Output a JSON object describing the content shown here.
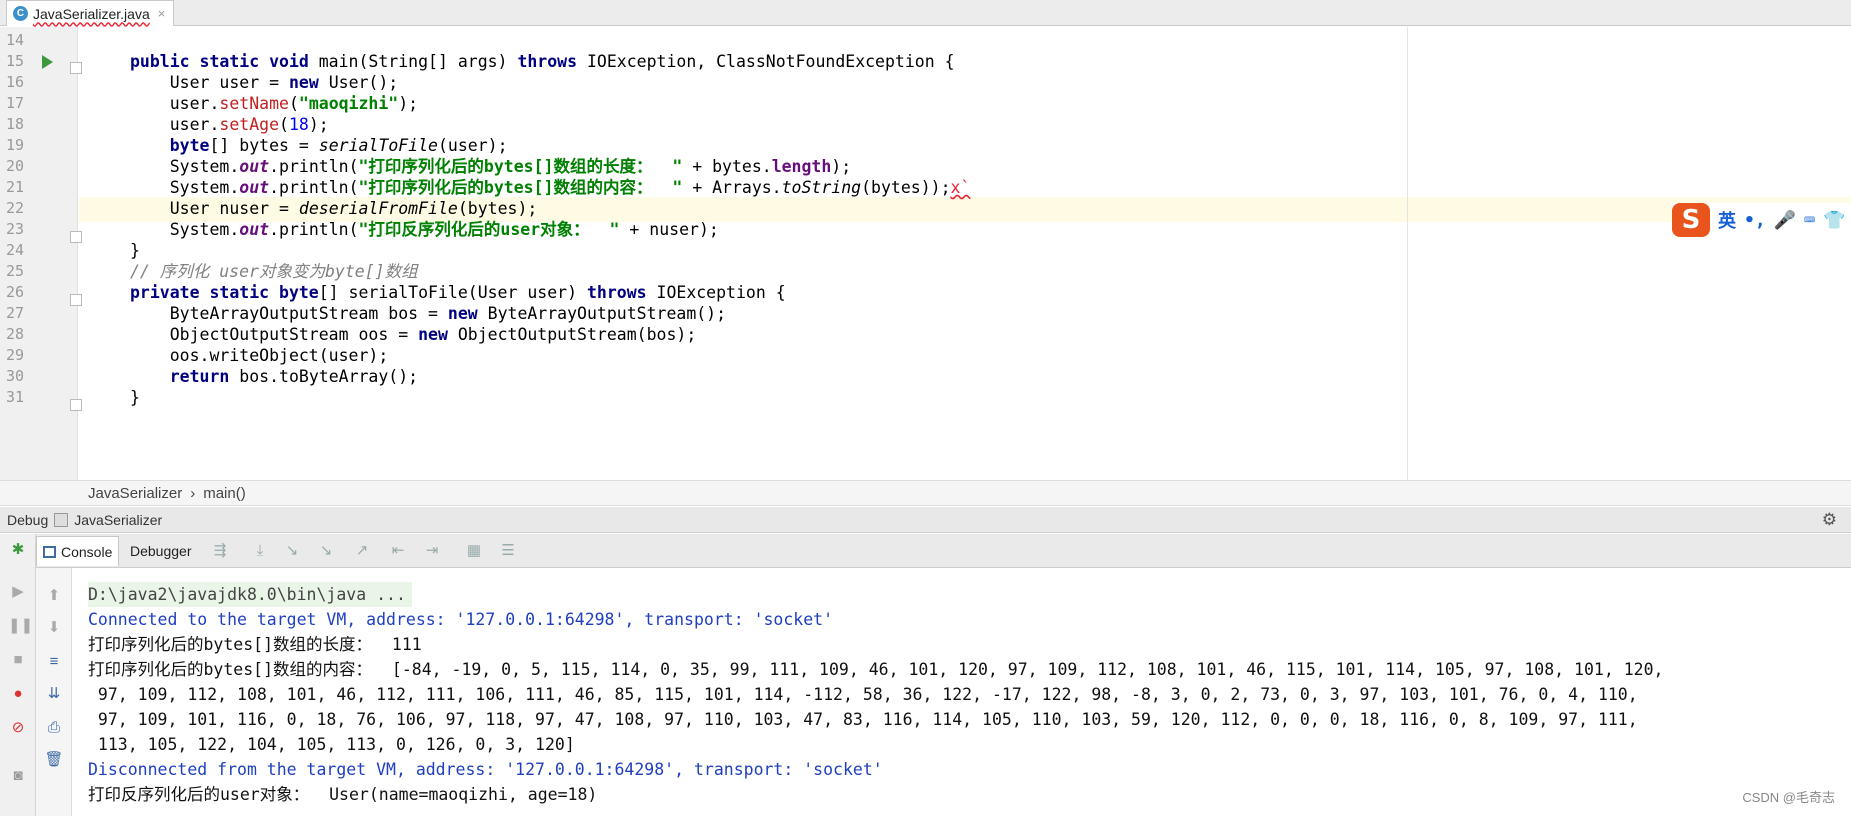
{
  "tab": {
    "filename": "JavaSerializer.java",
    "icon": "C",
    "close": "×"
  },
  "editor": {
    "line_numbers": [
      "14",
      "15",
      "16",
      "17",
      "18",
      "19",
      "20",
      "21",
      "22",
      "23",
      "24",
      "25",
      "26",
      "27",
      "28",
      "29",
      "30",
      "31"
    ]
  },
  "ime": {
    "logo": "S",
    "lang": "英",
    "punct": "•,",
    "mic": "🎤",
    "kbd": "⌨",
    "shirt": "👕"
  },
  "breadcrumb": {
    "class_name": "JavaSerializer",
    "sep": "›",
    "method": "main()"
  },
  "debug_panel": {
    "title": "Debug",
    "config": "JavaSerializer",
    "tab_console": "Console",
    "tab_debugger": "Debugger"
  },
  "console": {
    "cmd": "D:\\java2\\javajdk8.0\\bin\\java ...",
    "connected": "Connected to the target VM, address: '127.0.0.1:64298', transport: 'socket'",
    "length_line": "打印序列化后的bytes[]数组的长度：  111",
    "content_1": "打印序列化后的bytes[]数组的内容：  [-84, -19, 0, 5, 115, 114, 0, 35, 99, 111, 109, 46, 101, 120, 97, 109, 112, 108, 101, 46, 115, 101, 114, 105, 97, 108, 101, 120,",
    "content_2": " 97, 109, 112, 108, 101, 46, 112, 111, 106, 111, 46, 85, 115, 101, 114, -112, 58, 36, 122, -17, 122, 98, -8, 3, 0, 2, 73, 0, 3, 97, 103, 101, 76, 0, 4, 110,",
    "content_3": " 97, 109, 101, 116, 0, 18, 76, 106, 97, 118, 97, 47, 108, 97, 110, 103, 47, 83, 116, 114, 105, 110, 103, 59, 120, 112, 0, 0, 0, 18, 116, 0, 8, 109, 97, 111,",
    "content_4": " 113, 105, 122, 104, 105, 113, 0, 126, 0, 3, 120]",
    "disconnected": "Disconnected from the target VM, address: '127.0.0.1:64298', transport: 'socket'",
    "user_line": "打印反序列化后的user对象：  User(name=maoqizhi, age=18)"
  },
  "watermark": "CSDN @毛奇志"
}
